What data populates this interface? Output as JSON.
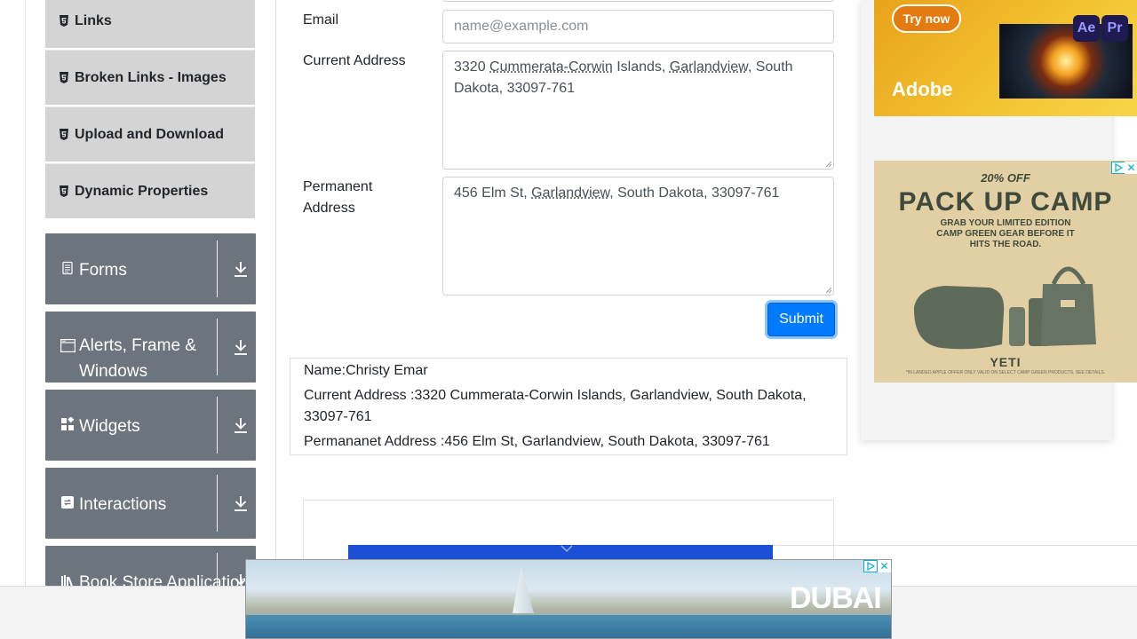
{
  "sidebar": {
    "element_items": [
      {
        "label": "Links",
        "icon": "html5-icon"
      },
      {
        "label": "Broken Links - Images",
        "icon": "html5-icon"
      },
      {
        "label": "Upload and Download",
        "icon": "html5-icon"
      },
      {
        "label": "Dynamic Properties",
        "icon": "html5-icon"
      }
    ],
    "groups": [
      {
        "label": "Forms",
        "icon": "form-icon"
      },
      {
        "label": "Alerts, Frame & Windows",
        "icon": "window-icon"
      },
      {
        "label": "Widgets",
        "icon": "widgets-icon"
      },
      {
        "label": "Interactions",
        "icon": "interactions-icon"
      },
      {
        "label": "Book Store Application",
        "icon": "book-icon"
      }
    ]
  },
  "form": {
    "email_label": "Email",
    "email_placeholder": "name@example.com",
    "current_address_label": "Current Address",
    "current_address_parts": [
      "3320 ",
      "Cummerata-Corwin",
      " Islands, ",
      "Garlandview",
      ", South Dakota, 33097-761"
    ],
    "permanent_address_label": "Permanent Address",
    "permanent_address_parts": [
      "456 Elm St, ",
      "Garlandview",
      ", South Dakota, 33097-761"
    ],
    "submit_label": "Submit"
  },
  "output": {
    "name": "Name:Christy Emar",
    "current_address": "Current Address :3320 Cummerata-Corwin Islands, Garlandview, South Dakota, 33097-761",
    "permanent_address": "Permananet Address :456 Elm St, Garlandview, South Dakota, 33097-761"
  },
  "ads": {
    "adobe": {
      "cta": "Try now",
      "brand": "Adobe",
      "apps": [
        "Ae",
        "Pr"
      ]
    },
    "yeti": {
      "promo": "20% OFF",
      "headline": "PACK UP CAMP",
      "sub": "GRAB YOUR LIMITED EDITION CAMP GREEN GEAR BEFORE IT HITS THE ROAD.",
      "brand": "YETI",
      "fine": "*IN LANDED APPLE OFFER ONLY VALID ON SELECT CAMP GREEN PRODUCTS. SEE DETAILS."
    },
    "dubai": {
      "brand": "DUBAI"
    }
  },
  "colors": {
    "sidebar_group_bg": "#6c757d",
    "sidebar_item_bg": "#d4d4d4",
    "primary": "#007bff"
  }
}
